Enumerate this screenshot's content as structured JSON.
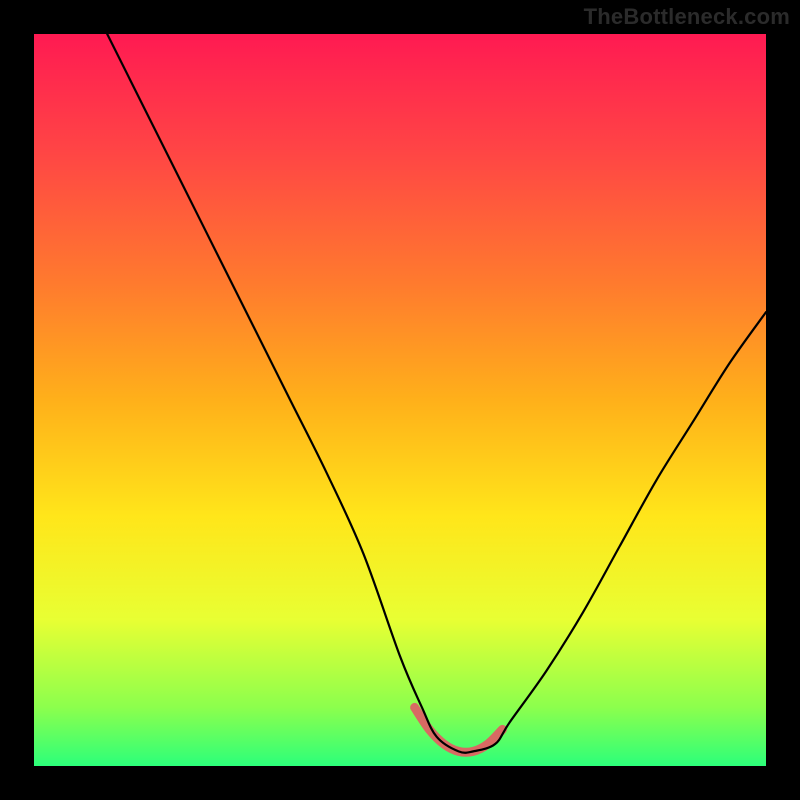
{
  "watermark": "TheBottleneck.com",
  "chart_data": {
    "type": "line",
    "title": "",
    "xlabel": "",
    "ylabel": "",
    "xlim": [
      0,
      100
    ],
    "ylim": [
      0,
      100
    ],
    "grid": false,
    "legend": false,
    "series": [
      {
        "name": "curve",
        "color": "#000000",
        "x": [
          10,
          15,
          20,
          25,
          30,
          35,
          40,
          45,
          50,
          53,
          55,
          58,
          60,
          63,
          65,
          70,
          75,
          80,
          85,
          90,
          95,
          100
        ],
        "y": [
          100,
          90,
          80,
          70,
          60,
          50,
          40,
          29,
          15,
          8,
          4,
          2,
          2,
          3,
          6,
          13,
          21,
          30,
          39,
          47,
          55,
          62
        ]
      },
      {
        "name": "highlight",
        "color": "#d86a63",
        "x": [
          52,
          54,
          56,
          58,
          60,
          62,
          64
        ],
        "y": [
          8,
          5,
          3,
          2,
          2,
          3,
          5
        ]
      }
    ],
    "background_gradient_stops": [
      {
        "pos": 0.0,
        "color": "#ff1a52"
      },
      {
        "pos": 0.16,
        "color": "#ff4545"
      },
      {
        "pos": 0.34,
        "color": "#ff7a2e"
      },
      {
        "pos": 0.5,
        "color": "#ffb01a"
      },
      {
        "pos": 0.66,
        "color": "#ffe61a"
      },
      {
        "pos": 0.8,
        "color": "#e8ff33"
      },
      {
        "pos": 0.92,
        "color": "#8cff4d"
      },
      {
        "pos": 1.0,
        "color": "#2cff7a"
      }
    ]
  }
}
